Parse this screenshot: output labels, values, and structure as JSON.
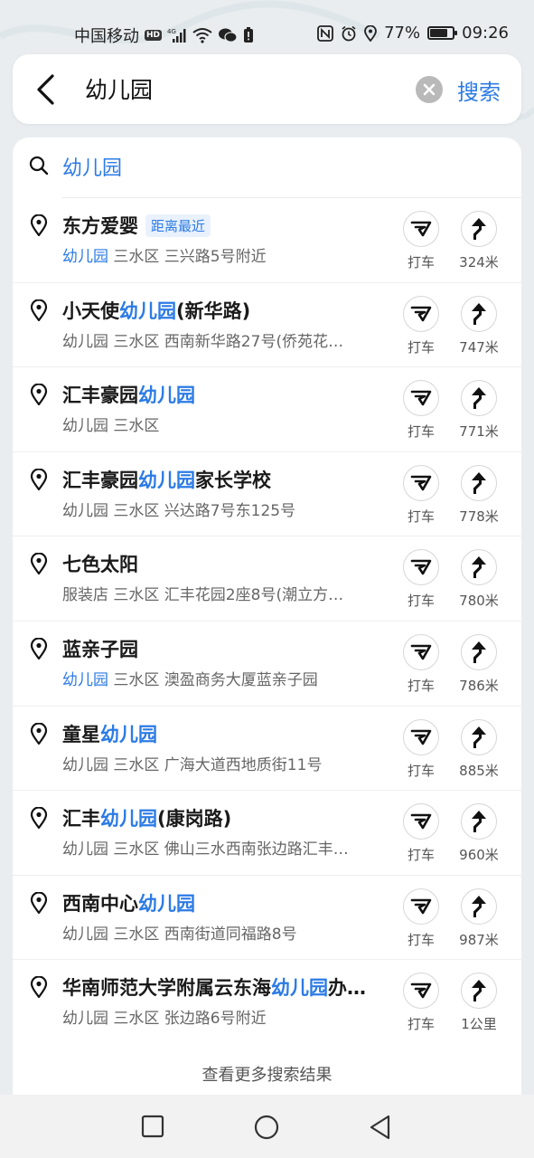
{
  "status_bar": {
    "carrier": "中国移动",
    "hd": "HD",
    "network": "4G",
    "battery_percent": "77%",
    "battery_level": 0.77,
    "time": "09:26"
  },
  "search": {
    "query": "幼儿园",
    "search_label": "搜索"
  },
  "suggestion": {
    "text": "幼儿园"
  },
  "results": [
    {
      "title_parts": [
        {
          "t": "东方爱婴",
          "h": false
        }
      ],
      "tag": "距离最近",
      "category": "幼儿园",
      "category_highlight": true,
      "address": "三水区 三兴路5号附近",
      "taxi": "打车",
      "distance": "324米"
    },
    {
      "title_parts": [
        {
          "t": "小天使",
          "h": false
        },
        {
          "t": "幼儿园",
          "h": true
        },
        {
          "t": "(新华路)",
          "h": false
        }
      ],
      "tag": "",
      "category": "幼儿园",
      "category_highlight": false,
      "address": "三水区 西南新华路27号(侨苑花…",
      "taxi": "打车",
      "distance": "747米"
    },
    {
      "title_parts": [
        {
          "t": "汇丰豪园",
          "h": false
        },
        {
          "t": "幼儿园",
          "h": true
        }
      ],
      "tag": "",
      "category": "幼儿园",
      "category_highlight": false,
      "address": "三水区",
      "taxi": "打车",
      "distance": "771米"
    },
    {
      "title_parts": [
        {
          "t": "汇丰豪园",
          "h": false
        },
        {
          "t": "幼儿园",
          "h": true
        },
        {
          "t": "家长学校",
          "h": false
        }
      ],
      "tag": "",
      "category": "幼儿园",
      "category_highlight": false,
      "address": "三水区 兴达路7号东125号",
      "taxi": "打车",
      "distance": "778米"
    },
    {
      "title_parts": [
        {
          "t": "七色太阳",
          "h": false
        }
      ],
      "tag": "",
      "category": "服装店",
      "category_highlight": false,
      "address": "三水区 汇丰花园2座8号(潮立方…",
      "taxi": "打车",
      "distance": "780米"
    },
    {
      "title_parts": [
        {
          "t": "蓝亲子园",
          "h": false
        }
      ],
      "tag": "",
      "category": "幼儿园",
      "category_highlight": true,
      "address": "三水区 澳盈商务大厦蓝亲子园",
      "taxi": "打车",
      "distance": "786米"
    },
    {
      "title_parts": [
        {
          "t": "童星",
          "h": false
        },
        {
          "t": "幼儿园",
          "h": true
        }
      ],
      "tag": "",
      "category": "幼儿园",
      "category_highlight": false,
      "address": "三水区 广海大道西地质街11号",
      "taxi": "打车",
      "distance": "885米"
    },
    {
      "title_parts": [
        {
          "t": "汇丰",
          "h": false
        },
        {
          "t": "幼儿园",
          "h": true
        },
        {
          "t": "(康岗路)",
          "h": false
        }
      ],
      "tag": "",
      "category": "幼儿园",
      "category_highlight": false,
      "address": "三水区 佛山三水西南张边路汇丰…",
      "taxi": "打车",
      "distance": "960米"
    },
    {
      "title_parts": [
        {
          "t": "西南中心",
          "h": false
        },
        {
          "t": "幼儿园",
          "h": true
        }
      ],
      "tag": "",
      "category": "幼儿园",
      "category_highlight": false,
      "address": "三水区 西南街道同福路8号",
      "taxi": "打车",
      "distance": "987米"
    },
    {
      "title_parts": [
        {
          "t": "华南师范大学附属云东海",
          "h": false
        },
        {
          "t": "幼儿园",
          "h": true
        },
        {
          "t": "办…",
          "h": false
        }
      ],
      "tag": "",
      "category": "幼儿园",
      "category_highlight": false,
      "address": "三水区 张边路6号附近",
      "taxi": "打车",
      "distance": "1公里"
    }
  ],
  "more_results_label": "查看更多搜索结果",
  "colors": {
    "accent": "#2c7be5",
    "text": "#1a1a1a",
    "subtext": "#666666"
  }
}
